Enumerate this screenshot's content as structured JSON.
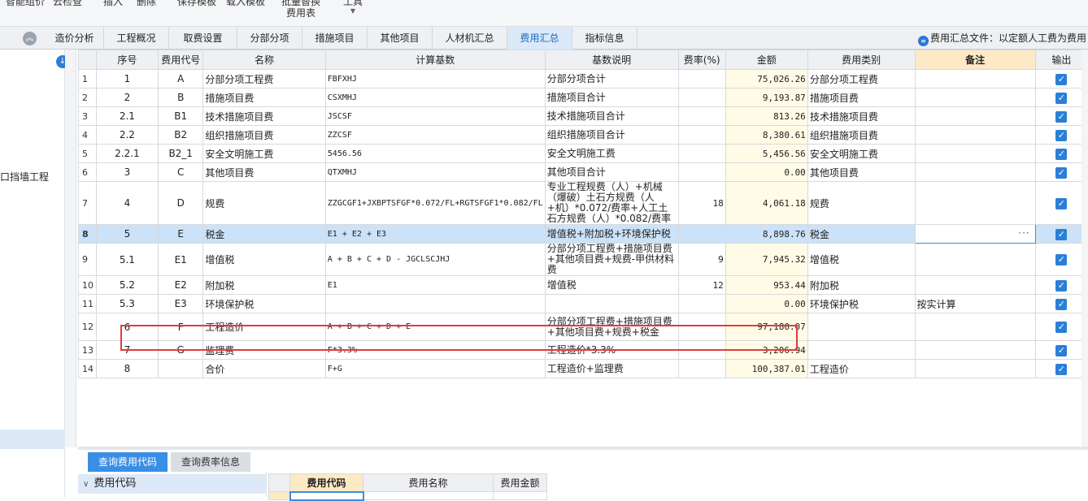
{
  "toolbar": {
    "items": [
      {
        "label": "智能组价"
      },
      {
        "label": "云检查"
      },
      {
        "label": "插入"
      },
      {
        "label": "删除"
      },
      {
        "label": "保存模板"
      },
      {
        "label": "载入模板"
      },
      {
        "label": "批量替换",
        "sub": "费用表"
      },
      {
        "label": "工具"
      }
    ]
  },
  "tabs": [
    "造价分析",
    "工程概况",
    "取费设置",
    "分部分项",
    "措施项目",
    "其他项目",
    "人材机汇总",
    "费用汇总",
    "指标信息"
  ],
  "active_tab": "费用汇总",
  "summary_file": "费用汇总文件：以定额人工费为费用",
  "left_panel": {
    "tree_item": "口挡墙工程"
  },
  "grid": {
    "headers": [
      "",
      "序号",
      "费用代号",
      "名称",
      "计算基数",
      "基数说明",
      "费率(%)",
      "金额",
      "费用类别",
      "备注",
      "输出"
    ],
    "rows": [
      {
        "idx": "1",
        "seq": "1",
        "code": "A",
        "name": "分部分项工程费",
        "base": "FBFXHJ",
        "desc": "分部分项合计",
        "rate": "",
        "amount": "75,026.26",
        "category": "分部分项工程费",
        "remark": ""
      },
      {
        "idx": "2",
        "seq": "2",
        "code": "B",
        "name": "措施项目费",
        "base": "CSXMHJ",
        "desc": "措施项目合计",
        "rate": "",
        "amount": "9,193.87",
        "category": "措施项目费",
        "remark": ""
      },
      {
        "idx": "3",
        "seq": "2.1",
        "code": "B1",
        "name": "技术措施项目费",
        "base": "JSCSF",
        "desc": "技术措施项目合计",
        "rate": "",
        "amount": "813.26",
        "category": "技术措施项目费",
        "remark": ""
      },
      {
        "idx": "4",
        "seq": "2.2",
        "code": "B2",
        "name": "组织措施项目费",
        "base": "ZZCSF",
        "desc": "组织措施项目合计",
        "rate": "",
        "amount": "8,380.61",
        "category": "组织措施项目费",
        "remark": ""
      },
      {
        "idx": "5",
        "seq": "2.2.1",
        "code": "B2_1",
        "name": "安全文明施工费",
        "base": "5456.56",
        "desc": "安全文明施工费",
        "rate": "",
        "amount": "5,456.56",
        "category": "安全文明施工费",
        "remark": ""
      },
      {
        "idx": "6",
        "seq": "3",
        "code": "C",
        "name": "其他项目费",
        "base": "QTXMHJ",
        "desc": "其他项目合计",
        "rate": "",
        "amount": "0.00",
        "category": "其他项目费",
        "remark": ""
      },
      {
        "idx": "7",
        "seq": "4",
        "code": "D",
        "name": "规费",
        "base": "ZZGCGF1+JXBPTSFGF*0.072/FL+RGTSFGF1*0.082/FL",
        "desc": "专业工程规费（人）+机械（爆破）土石方规费（人+机）*0.072/费率+人工土石方规费（人）*0.082/费率",
        "rate": "18",
        "amount": "4,061.18",
        "category": "规费",
        "remark": ""
      },
      {
        "idx": "8",
        "seq": "5",
        "code": "E",
        "name": "税金",
        "base": "E1 + E2 + E3",
        "desc": "增值税+附加税+环境保护税",
        "rate": "",
        "amount": "8,898.76",
        "category": "税金",
        "remark": ""
      },
      {
        "idx": "9",
        "seq": "5.1",
        "code": "E1",
        "name": "增值税",
        "base": "A + B + C + D - JGCLSCJHJ",
        "desc": "分部分项工程费+措施项目费+其他项目费+规费-甲供材料费",
        "rate": "9",
        "amount": "7,945.32",
        "category": "增值税",
        "remark": ""
      },
      {
        "idx": "10",
        "seq": "5.2",
        "code": "E2",
        "name": "附加税",
        "base": "E1",
        "desc": "增值税",
        "rate": "12",
        "amount": "953.44",
        "category": "附加税",
        "remark": ""
      },
      {
        "idx": "11",
        "seq": "5.3",
        "code": "E3",
        "name": "环境保护税",
        "base": "",
        "desc": "",
        "rate": "",
        "amount": "0.00",
        "category": "环境保护税",
        "remark": "按实计算"
      },
      {
        "idx": "12",
        "seq": "6",
        "code": "F",
        "name": "工程造价",
        "base": "A + B + C + D + E",
        "desc": "分部分项工程费+措施项目费+其他项目费+规费+税金",
        "rate": "",
        "amount": "97,180.07",
        "category": "",
        "remark": ""
      },
      {
        "idx": "13",
        "seq": "7",
        "code": "G",
        "name": "监理费",
        "base": "F*3.3%",
        "desc": "工程造价*3.3%",
        "rate": "",
        "amount": "3,206.94",
        "category": "",
        "remark": ""
      },
      {
        "idx": "14",
        "seq": "8",
        "code": "",
        "name": "合价",
        "base": "F+G",
        "desc": "工程造价+监理费",
        "rate": "",
        "amount": "100,387.01",
        "category": "工程造价",
        "remark": ""
      }
    ],
    "selected_row": "8",
    "highlighted_row": "13",
    "output_checked": true
  },
  "bottom": {
    "tabs": [
      "查询费用代码",
      "查询费率信息"
    ],
    "active_tab": "查询费用代码",
    "tree_header": "费用代码",
    "grid_headers": [
      "费用代码",
      "费用名称",
      "费用金额"
    ]
  },
  "colors": {
    "accent": "#2a7fd6",
    "active_tab_bg": "#dbe9f8",
    "highlight_box": "#e33b3b",
    "remark_header": "#fde9c5"
  },
  "icons": {
    "collapse": "double-chevron-up-icon",
    "left_down": "arrow-down-circle-icon",
    "summary_file": "file-list-icon",
    "output": "checkbox-checked-icon",
    "tree_expand": "chevron-down-icon"
  }
}
